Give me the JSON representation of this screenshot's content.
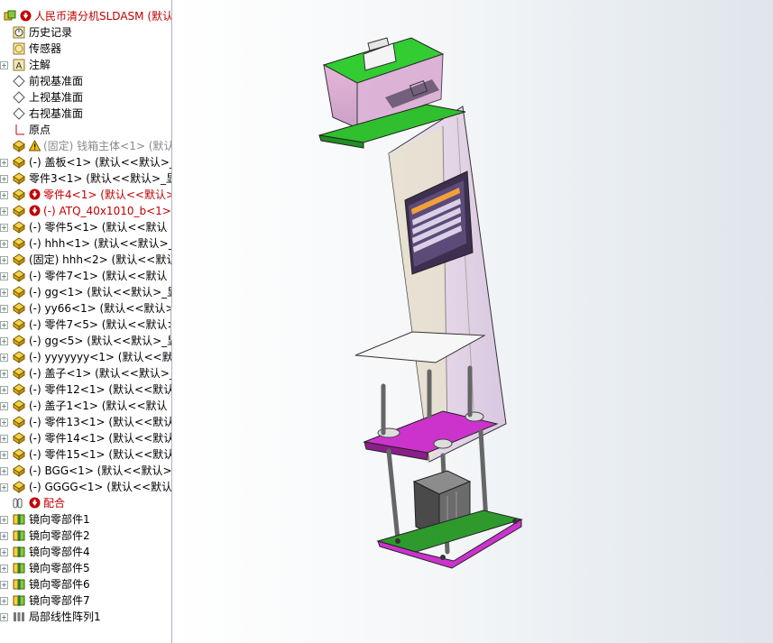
{
  "tree": {
    "rows": [
      {
        "label": "人民币清分机SLDASM  (默认",
        "icon": "assembly-icon",
        "badge": "red-arrow",
        "tone": "red",
        "indent": 0,
        "expand": false
      },
      {
        "label": "历史记录",
        "icon": "history-icon",
        "indent": 1,
        "expand": false
      },
      {
        "label": "传感器",
        "icon": "sensor-icon",
        "indent": 1,
        "expand": false
      },
      {
        "label": "注解",
        "icon": "annotation-icon",
        "indent": 1,
        "expand": true
      },
      {
        "label": "前视基准面",
        "icon": "plane-icon",
        "indent": 1,
        "expand": false
      },
      {
        "label": "上视基准面",
        "icon": "plane-icon",
        "indent": 1,
        "expand": false
      },
      {
        "label": "右视基准面",
        "icon": "plane-icon",
        "indent": 1,
        "expand": false
      },
      {
        "label": "原点",
        "icon": "origin-icon",
        "indent": 1,
        "expand": false
      },
      {
        "label": "(固定) 钱箱主体<1> (默认",
        "icon": "part-icon",
        "badge": "warning",
        "tone": "grey",
        "indent": 1,
        "expand": false
      },
      {
        "label": "(-) 盖板<1> (默认<<默认>_",
        "icon": "part-icon",
        "indent": 1,
        "expand": true
      },
      {
        "label": "零件3<1> (默认<<默认>_显",
        "icon": "part-icon",
        "indent": 1,
        "expand": true
      },
      {
        "label": "零件4<1> (默认<<默认>",
        "icon": "part-icon",
        "badge": "red-arrow",
        "tone": "red",
        "indent": 1,
        "expand": true
      },
      {
        "label": "(-) ATQ_40x1010_b<1>",
        "icon": "part-icon",
        "badge": "red-arrow",
        "tone": "red",
        "indent": 1,
        "expand": true
      },
      {
        "label": "(-) 零件5<1> (默认<<默认",
        "icon": "part-icon",
        "indent": 1,
        "expand": true
      },
      {
        "label": "(-) hhh<1> (默认<<默认>_",
        "icon": "part-icon",
        "indent": 1,
        "expand": true
      },
      {
        "label": "(固定) hhh<2> (默认<<默认",
        "icon": "part-icon",
        "indent": 1,
        "expand": true
      },
      {
        "label": "(-) 零件7<1> (默认<<默认",
        "icon": "part-icon",
        "indent": 1,
        "expand": true
      },
      {
        "label": "(-) gg<1> (默认<<默认>_显",
        "icon": "part-icon",
        "indent": 1,
        "expand": true
      },
      {
        "label": "(-) yy66<1> (默认<<默认>",
        "icon": "part-icon",
        "indent": 1,
        "expand": true
      },
      {
        "label": "(-) 零件7<5> (默认<<默认>",
        "icon": "part-icon",
        "indent": 1,
        "expand": true
      },
      {
        "label": "(-) gg<5> (默认<<默认>_显",
        "icon": "part-icon",
        "indent": 1,
        "expand": true
      },
      {
        "label": "(-) yyyyyyy<1> (默认<<默认",
        "icon": "part-icon",
        "indent": 1,
        "expand": true
      },
      {
        "label": "(-) 盖子<1> (默认<<默认>_",
        "icon": "part-icon",
        "indent": 1,
        "expand": true
      },
      {
        "label": "(-) 零件12<1> (默认<<默认",
        "icon": "part-icon",
        "indent": 1,
        "expand": true
      },
      {
        "label": "(-) 盖子1<1> (默认<<默认",
        "icon": "part-icon",
        "indent": 1,
        "expand": true
      },
      {
        "label": "(-) 零件13<1> (默认<<默认",
        "icon": "part-icon",
        "indent": 1,
        "expand": true
      },
      {
        "label": "(-) 零件14<1> (默认<<默认",
        "icon": "part-icon",
        "indent": 1,
        "expand": true
      },
      {
        "label": "(-) 零件15<1> (默认<<默认",
        "icon": "part-icon",
        "indent": 1,
        "expand": true
      },
      {
        "label": "(-) BGG<1> (默认<<默认>_",
        "icon": "part-icon",
        "indent": 1,
        "expand": true
      },
      {
        "label": "(-) GGGG<1> (默认<<默认",
        "icon": "part-icon",
        "indent": 1,
        "expand": true
      },
      {
        "label": "配合",
        "icon": "mates-icon",
        "badge": "red-arrow",
        "tone": "red",
        "indent": 1,
        "expand": false
      },
      {
        "label": "镜向零部件1",
        "icon": "mirror-icon",
        "indent": 1,
        "expand": true
      },
      {
        "label": "镜向零部件2",
        "icon": "mirror-icon",
        "indent": 1,
        "expand": true
      },
      {
        "label": "镜向零部件4",
        "icon": "mirror-icon",
        "indent": 1,
        "expand": true
      },
      {
        "label": "镜向零部件5",
        "icon": "mirror-icon",
        "indent": 1,
        "expand": true
      },
      {
        "label": "镜向零部件6",
        "icon": "mirror-icon",
        "indent": 1,
        "expand": true
      },
      {
        "label": "镜向零部件7",
        "icon": "mirror-icon",
        "indent": 1,
        "expand": true
      },
      {
        "label": "局部线性阵列1",
        "icon": "pattern-icon",
        "indent": 1,
        "expand": true
      }
    ]
  },
  "colors": {
    "error_red": "#c00000",
    "suppressed_grey": "#8a8a8a",
    "part_yellow": "#e8c33a",
    "model_green": "#33cc33",
    "model_magenta": "#cc33cc",
    "model_glass": "#d9c8e0",
    "model_orange": "#f2a03a"
  }
}
